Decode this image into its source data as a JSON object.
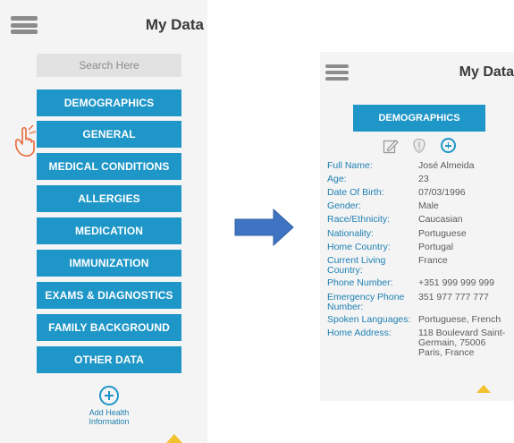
{
  "left": {
    "title": "My Data",
    "search_placeholder": "Search Here",
    "categories": [
      "DEMOGRAPHICS",
      "GENERAL",
      "MEDICAL CONDITIONS",
      "ALLERGIES",
      "MEDICATION",
      "IMMUNIZATION",
      "EXAMS & DIAGNOSTICS",
      "FAMILY BACKGROUND",
      "OTHER DATA"
    ],
    "add_label_line1": "Add Health",
    "add_label_line2": "Information"
  },
  "right": {
    "title": "My Data",
    "category": "DEMOGRAPHICS",
    "fields": [
      {
        "label": "Full Name:",
        "value": "José Almeida"
      },
      {
        "label": "Age:",
        "value": "23"
      },
      {
        "label": "Date Of Birth:",
        "value": "07/03/1996"
      },
      {
        "label": "Gender:",
        "value": "Male"
      },
      {
        "label": "Race/Ethnicity:",
        "value": "Caucasian"
      },
      {
        "label": "Nationality:",
        "value": "Portuguese"
      },
      {
        "label": "Home Country:",
        "value": "Portugal"
      },
      {
        "label": "Current Living Country:",
        "value": "France"
      },
      {
        "label": "Phone Number:",
        "value": "+351 999 999 999"
      },
      {
        "label": "Emergency Phone Number:",
        "value": "351 977 777 777"
      },
      {
        "label": "Spoken Languages:",
        "value": "Portuguese, French"
      },
      {
        "label": "Home Address:",
        "value": "118 Boulevard Saint-Germain, 75006 Paris, France"
      }
    ]
  },
  "colors": {
    "accent": "#1e96c8",
    "label_blue": "#1e80b3",
    "arrow": "#3f74c2",
    "scroll_indicator": "#f2c12e"
  },
  "icons": {
    "menu": "hamburger-icon",
    "pointer": "hand-pointer-icon",
    "edit": "edit-icon",
    "shield": "shield-icon",
    "add": "plus-circle-icon",
    "transition": "right-arrow-icon"
  }
}
